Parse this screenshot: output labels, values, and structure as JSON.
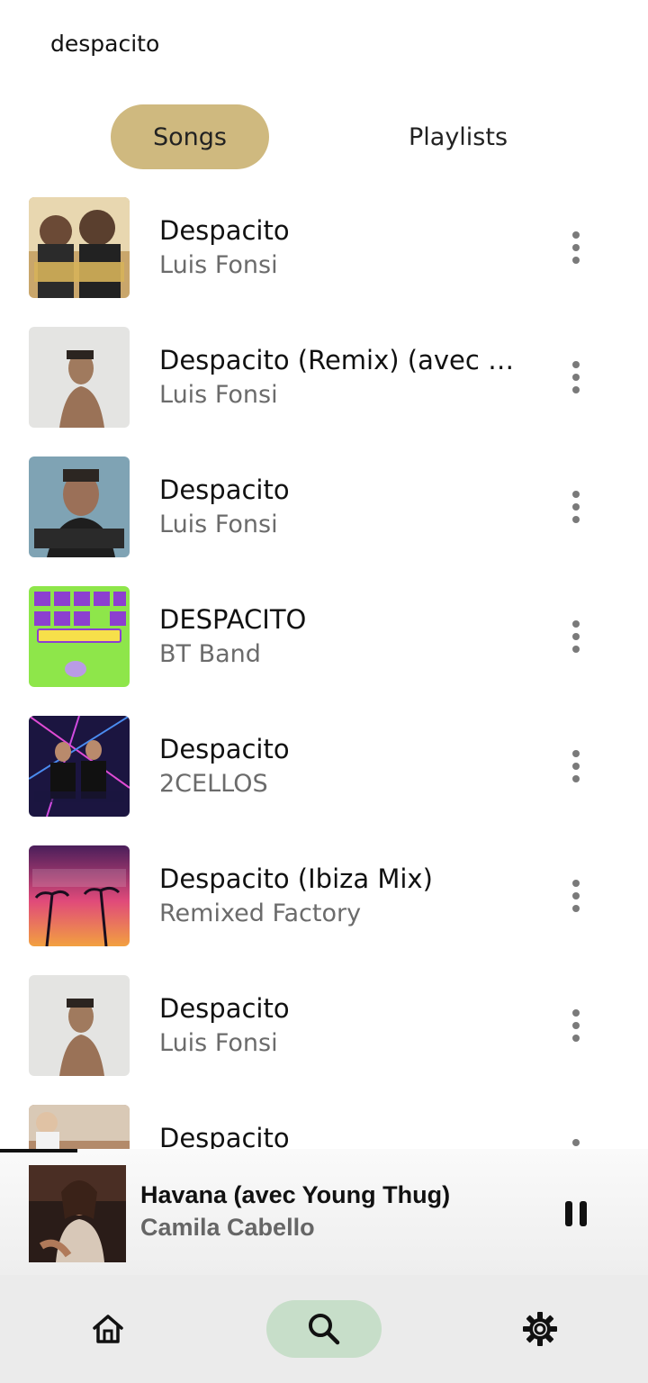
{
  "search": {
    "query": "despacito"
  },
  "tabs": [
    {
      "label": "Songs",
      "active": true
    },
    {
      "label": "Playlists",
      "active": false
    }
  ],
  "songs": [
    {
      "title": "Despacito",
      "artist": "Luis Fonsi",
      "cover": "despacito-feat-daddy-yankee-cover"
    },
    {
      "title": "Despacito (Remix) (avec Justin Bieber)",
      "artist": "Luis Fonsi",
      "cover": "vida-cover"
    },
    {
      "title": "Despacito",
      "artist": "Luis Fonsi",
      "cover": "despacito-version-pop-cover"
    },
    {
      "title": "DESPACITO",
      "artist": "BT Band",
      "cover": "radio-hits-karaoke-cover"
    },
    {
      "title": "Despacito",
      "artist": "2CELLOS",
      "cover": "2cellos-cover"
    },
    {
      "title": "Despacito (Ibiza Mix)",
      "artist": "Remixed Factory",
      "cover": "house-mix-tropical-cover"
    },
    {
      "title": "Despacito",
      "artist": "Luis Fonsi",
      "cover": "vida-cover"
    },
    {
      "title": "Despacito",
      "artist": "",
      "cover": "photo-cover"
    }
  ],
  "now_playing": {
    "title": "Havana (avec Young Thug)",
    "artist": "Camila Cabello",
    "progress": 0.12,
    "cover": "camila-cabello-cover"
  },
  "nav": {
    "items": [
      {
        "icon": "home-icon",
        "active": false
      },
      {
        "icon": "search-icon",
        "active": true
      },
      {
        "icon": "gear-icon",
        "active": false
      }
    ]
  },
  "colors": {
    "tab_active": "#cfb97f",
    "nav_active": "#c7dec9",
    "nav_background": "#ebebeb",
    "artist_text": "#6b6b6b"
  }
}
